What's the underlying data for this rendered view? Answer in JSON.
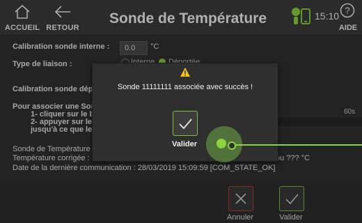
{
  "header": {
    "home_label": "ACCUEIL",
    "back_label": "RETOUR",
    "title": "Sonde de Température",
    "time": "15:10",
    "help_label": "AIDE"
  },
  "content": {
    "calibration_label": "Calibration sonde interne :",
    "calibration_value": "0.0",
    "calibration_unit": "°C",
    "liaison_label": "Type de liaison :",
    "radio_internal": "Interne",
    "radio_remote": "Déportée",
    "calibration_remote_label": "Calibration sonde dépor",
    "assoc_line1": "Pour associer une Sond",
    "assoc_line2": "1- cliquer sur le bo",
    "assoc_line3": "2- appuyer sur le b",
    "assoc_line4": "jusqu'à ce que le v",
    "seconds": "60s",
    "probe_line": "Sonde de Température a",
    "corrected_temp": "Température corrigée : 2",
    "corrected_temp_tail": "ou ??? °C",
    "last_comm": "Date de la dernière communication : 28/03/2019 15:09:59  [COM_STATE_OK]"
  },
  "footer": {
    "cancel_label": "Annuler",
    "validate_label": "Valider"
  },
  "dialog": {
    "message": "Sonde 11111111 associée avec succès !",
    "button_label": "Valider"
  },
  "colors": {
    "accent_green": "#8ad43e",
    "cancel_red": "#c0392b",
    "warning_yellow": "#f5c518"
  }
}
